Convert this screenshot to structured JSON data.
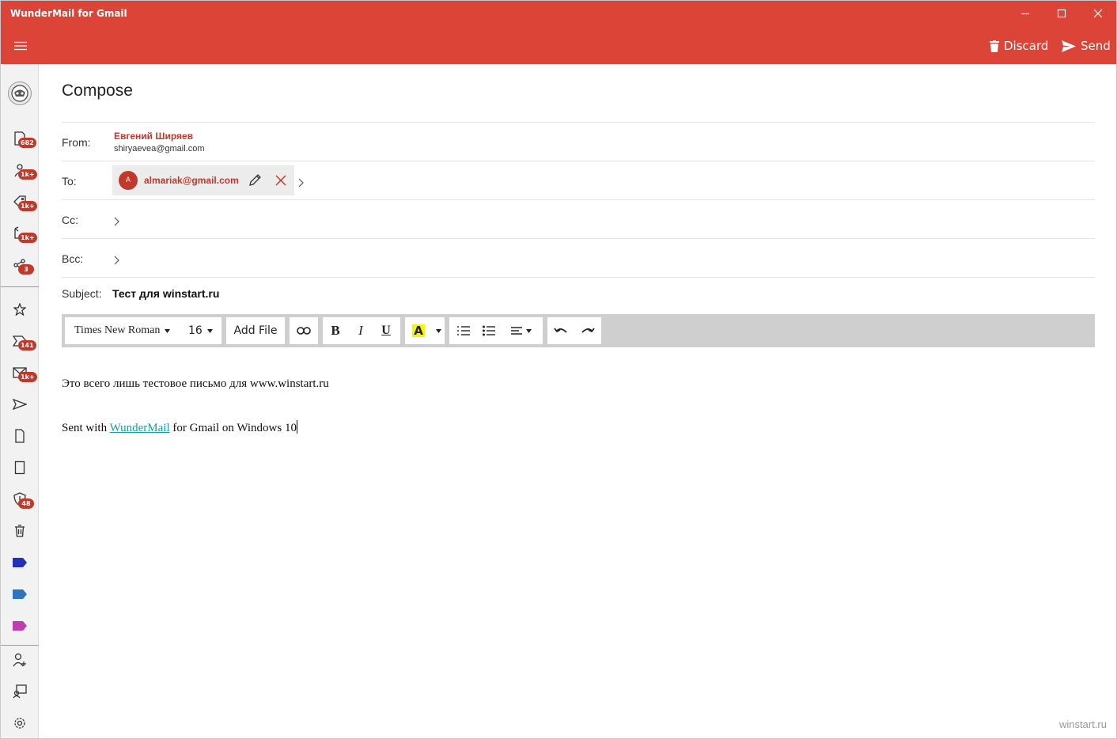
{
  "window": {
    "title": "WunderMail for Gmail"
  },
  "header": {
    "discard_label": "Discard",
    "send_label": "Send"
  },
  "sidebar": {
    "badges": [
      "682",
      "1k+",
      "1k+",
      "1k+",
      "3",
      "141",
      "1k+",
      "48"
    ],
    "label_colors": [
      "#2231b8",
      "#2f74c0",
      "#c03cb3"
    ]
  },
  "compose": {
    "title": "Compose",
    "from_label": "From:",
    "from_name": "Евгений Ширяев",
    "from_email": "shiryaevea@gmail.com",
    "to_label": "To:",
    "to_recipient": {
      "initial": "A",
      "email": "almariak@gmail.com"
    },
    "cc_label": "Cc:",
    "bcc_label": "Bcc:",
    "subject_label": "Subject:",
    "subject_value": "Тест для winstart.ru"
  },
  "toolbar": {
    "font_family": "Times New Roman",
    "font_size": "16",
    "add_file_label": "Add File",
    "bold": "B",
    "italic": "I",
    "underline": "U",
    "highlight": "A",
    "highlight_color": "#f5f500"
  },
  "body": {
    "line1": "Это всего лишь тестовое письмо для www.winstart.ru",
    "signature_prefix": "Sent with ",
    "signature_link": "WunderMail",
    "signature_suffix": " for Gmail on Windows 10"
  },
  "watermark": "winstart.ru"
}
